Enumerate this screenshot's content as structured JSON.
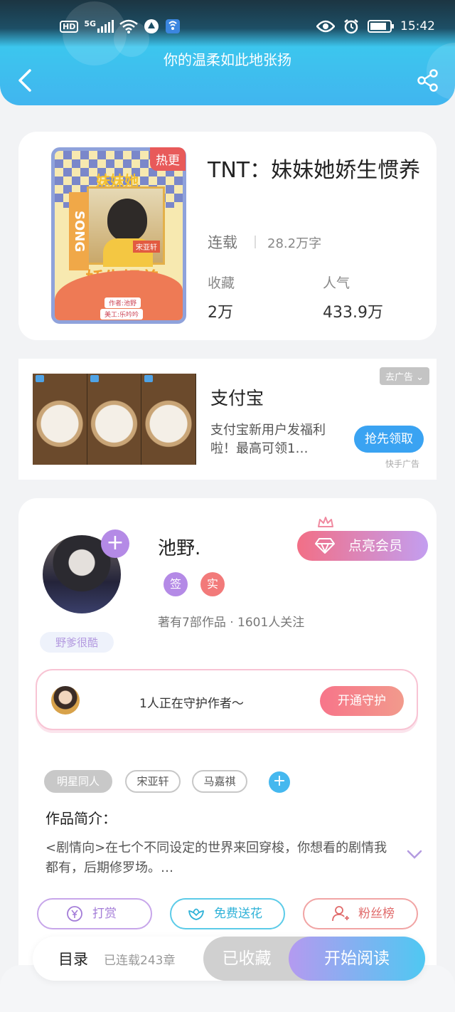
{
  "status_bar": {
    "hd": "HD",
    "network": "5G",
    "time": "15:42"
  },
  "header": {
    "title": "你的温柔如此地张扬"
  },
  "book": {
    "hot_tag": "热更",
    "title": "TNT：妹妹她娇生惯养",
    "status": "连载",
    "word_count": "28.2万字",
    "favorites_label": "收藏",
    "favorites_value": "2万",
    "popularity_label": "人气",
    "popularity_value": "433.9万",
    "cover": {
      "mini_title": "妹妹她",
      "side_text": "SONG",
      "title": "娇生惯养",
      "name_tag": "宋亚轩",
      "credit_author": "作者:池野",
      "credit_art": "美工:乐吟吟"
    }
  },
  "ad": {
    "brand": "支付宝",
    "description": "支付宝新用户发福利啦！最高可领1…",
    "close_label": "去广告",
    "cta_label": "抢先领取",
    "source": "快手广告"
  },
  "author": {
    "name": "池野.",
    "badge_sign": "签",
    "badge_real": "实",
    "stats": "著有7部作品 · 1601人关注",
    "tag": "野爹很酷",
    "vip_label": "点亮会员",
    "plus_label": "+"
  },
  "guard": {
    "text": "1人正在守护作者～",
    "button": "开通守护"
  },
  "tags": [
    {
      "label": "明星同人"
    },
    {
      "label": "宋亚轩"
    },
    {
      "label": "马嘉祺"
    }
  ],
  "tag_add": "+",
  "intro": {
    "label": "作品简介：",
    "text": "<剧情向>在七个不同设定的世界来回穿梭，你想看的剧情我都有，后期修罗场。…"
  },
  "actions": {
    "reward": "打赏",
    "flowers": "免费送花",
    "fans": "粉丝榜"
  },
  "bottom": {
    "toc": "目录",
    "chapters": "已连载243章",
    "favorited": "已收藏",
    "read": "开始阅读"
  },
  "colors": {
    "accent_blue": "#41b5ef",
    "accent_purple": "#b48ae6",
    "accent_pink": "#f7758a"
  }
}
